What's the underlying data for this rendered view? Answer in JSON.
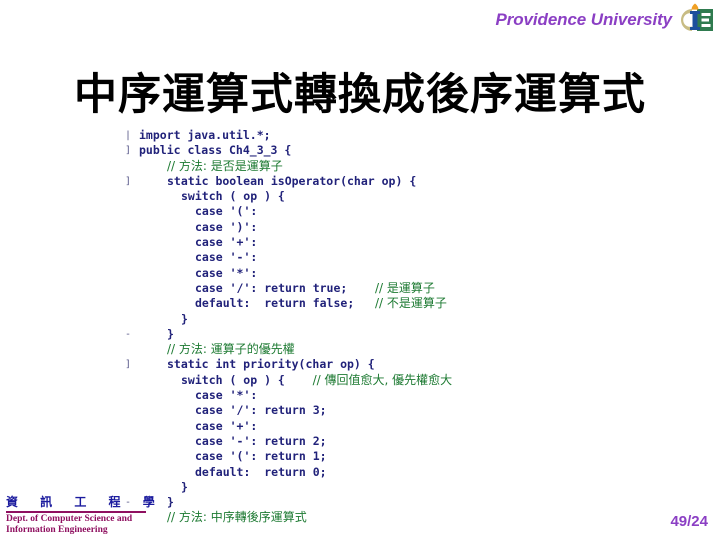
{
  "header": {
    "brand": "Providence University",
    "brand_color": "#8b3fc4",
    "logo_name": "providence-university-logo"
  },
  "title": "中序運算式轉換成後序運算式",
  "code": {
    "language": "java",
    "lines": [
      {
        "gutter": "|",
        "indent": 0,
        "tokens": [
          {
            "t": "import java.util.*;",
            "c": "kw"
          }
        ]
      },
      {
        "gutter": "]",
        "indent": 0,
        "tokens": [
          {
            "t": "public class Ch4_3_3 {",
            "c": "kw"
          }
        ]
      },
      {
        "gutter": "",
        "indent": 2,
        "tokens": [
          {
            "t": "// 方法: 是否是運算子",
            "c": "cmt-cjk"
          }
        ]
      },
      {
        "gutter": "]",
        "indent": 2,
        "tokens": [
          {
            "t": "static boolean isOperator(char op) {",
            "c": "kw"
          }
        ]
      },
      {
        "gutter": "",
        "indent": 3,
        "tokens": [
          {
            "t": "switch ( op ) {",
            "c": "kw"
          }
        ]
      },
      {
        "gutter": "",
        "indent": 4,
        "tokens": [
          {
            "t": "case '(':",
            "c": "kw"
          }
        ]
      },
      {
        "gutter": "",
        "indent": 4,
        "tokens": [
          {
            "t": "case ')':",
            "c": "kw"
          }
        ]
      },
      {
        "gutter": "",
        "indent": 4,
        "tokens": [
          {
            "t": "case '+':",
            "c": "kw"
          }
        ]
      },
      {
        "gutter": "",
        "indent": 4,
        "tokens": [
          {
            "t": "case '-':",
            "c": "kw"
          }
        ]
      },
      {
        "gutter": "",
        "indent": 4,
        "tokens": [
          {
            "t": "case '*':",
            "c": "kw"
          }
        ]
      },
      {
        "gutter": "",
        "indent": 4,
        "tokens": [
          {
            "t": "case '/': return true;    ",
            "c": "kw"
          },
          {
            "t": "// 是運算子",
            "c": "cmt-cjk"
          }
        ]
      },
      {
        "gutter": "",
        "indent": 4,
        "tokens": [
          {
            "t": "default:  return false;   ",
            "c": "kw"
          },
          {
            "t": "// 不是運算子",
            "c": "cmt-cjk"
          }
        ]
      },
      {
        "gutter": "",
        "indent": 3,
        "tokens": [
          {
            "t": "}",
            "c": "kw"
          }
        ]
      },
      {
        "gutter": "-",
        "indent": 2,
        "tokens": [
          {
            "t": "}",
            "c": "kw"
          }
        ]
      },
      {
        "gutter": "",
        "indent": 2,
        "tokens": [
          {
            "t": "// 方法: 運算子的優先權",
            "c": "cmt-cjk"
          }
        ]
      },
      {
        "gutter": "]",
        "indent": 2,
        "tokens": [
          {
            "t": "static int priority(char op) {",
            "c": "kw"
          }
        ]
      },
      {
        "gutter": "",
        "indent": 3,
        "tokens": [
          {
            "t": "switch ( op ) {    ",
            "c": "kw"
          },
          {
            "t": "// 傳回值愈大, 優先權愈大",
            "c": "cmt-cjk"
          }
        ]
      },
      {
        "gutter": "",
        "indent": 4,
        "tokens": [
          {
            "t": "case '*':",
            "c": "kw"
          }
        ]
      },
      {
        "gutter": "",
        "indent": 4,
        "tokens": [
          {
            "t": "case '/': return 3;",
            "c": "kw"
          }
        ]
      },
      {
        "gutter": "",
        "indent": 4,
        "tokens": [
          {
            "t": "case '+':",
            "c": "kw"
          }
        ]
      },
      {
        "gutter": "",
        "indent": 4,
        "tokens": [
          {
            "t": "case '-': return 2;",
            "c": "kw"
          }
        ]
      },
      {
        "gutter": "",
        "indent": 4,
        "tokens": [
          {
            "t": "case '(': return 1;",
            "c": "kw"
          }
        ]
      },
      {
        "gutter": "",
        "indent": 4,
        "tokens": [
          {
            "t": "default:  return 0;",
            "c": "kw"
          }
        ]
      },
      {
        "gutter": "",
        "indent": 3,
        "tokens": [
          {
            "t": "}",
            "c": "kw"
          }
        ]
      },
      {
        "gutter": "-",
        "indent": 2,
        "tokens": [
          {
            "t": "}",
            "c": "kw"
          }
        ]
      },
      {
        "gutter": "",
        "indent": 2,
        "tokens": [
          {
            "t": "// 方法: 中序轉後序運算式",
            "c": "cmt-cjk"
          }
        ]
      }
    ]
  },
  "footer": {
    "dept_cjk": "資 訊 工 程 學",
    "dept_en_line1": "Dept. of Computer Science and",
    "dept_en_line2": "Information Engineering",
    "rule_color": "#8f1060",
    "cjk_color": "#1b1b9e"
  },
  "page": {
    "number": "49/24",
    "color": "#8b3fc4"
  }
}
